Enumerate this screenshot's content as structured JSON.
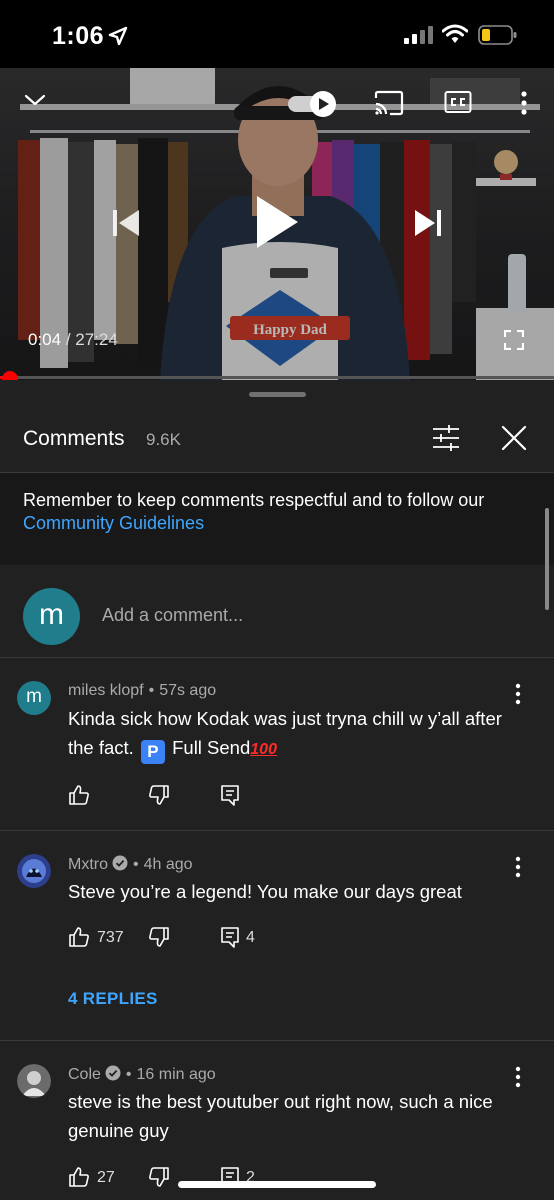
{
  "status_bar": {
    "time": "1:06"
  },
  "video": {
    "current_time": "0:04",
    "duration": "27:24",
    "progress": 0.0024,
    "shirt_text": "Happy Dad"
  },
  "comments_panel": {
    "title": "Comments",
    "count": "9.6K",
    "guidelines_text": "Remember to keep comments respectful and to follow our ",
    "guidelines_link": "Community Guidelines",
    "add_comment": {
      "avatar_letter": "m",
      "placeholder": "Add a comment..."
    }
  },
  "comments": [
    {
      "author": "miles klopf",
      "time": "57s ago",
      "avatar_letter": "m",
      "text_before": "Kinda sick how Kodak was just tryna chill w y’all after the fact.",
      "badge": "P",
      "text_after": "Full Send",
      "emoji": "100",
      "likes": "",
      "replies_count": ""
    },
    {
      "author": "Mxtro",
      "time": "4h ago",
      "text": "Steve you’re a legend! You make our days great",
      "likes": "737",
      "replies_count": "4",
      "replies_link": "4 REPLIES"
    },
    {
      "author": "Cole",
      "time": "16 min ago",
      "text": "steve is the best youtuber out right now, such a nice genuine guy",
      "likes": "27",
      "replies_count": "2"
    }
  ],
  "colors": {
    "accent_red": "#ff0000",
    "link_blue": "#3ea6ff",
    "panel_bg": "#212121"
  }
}
